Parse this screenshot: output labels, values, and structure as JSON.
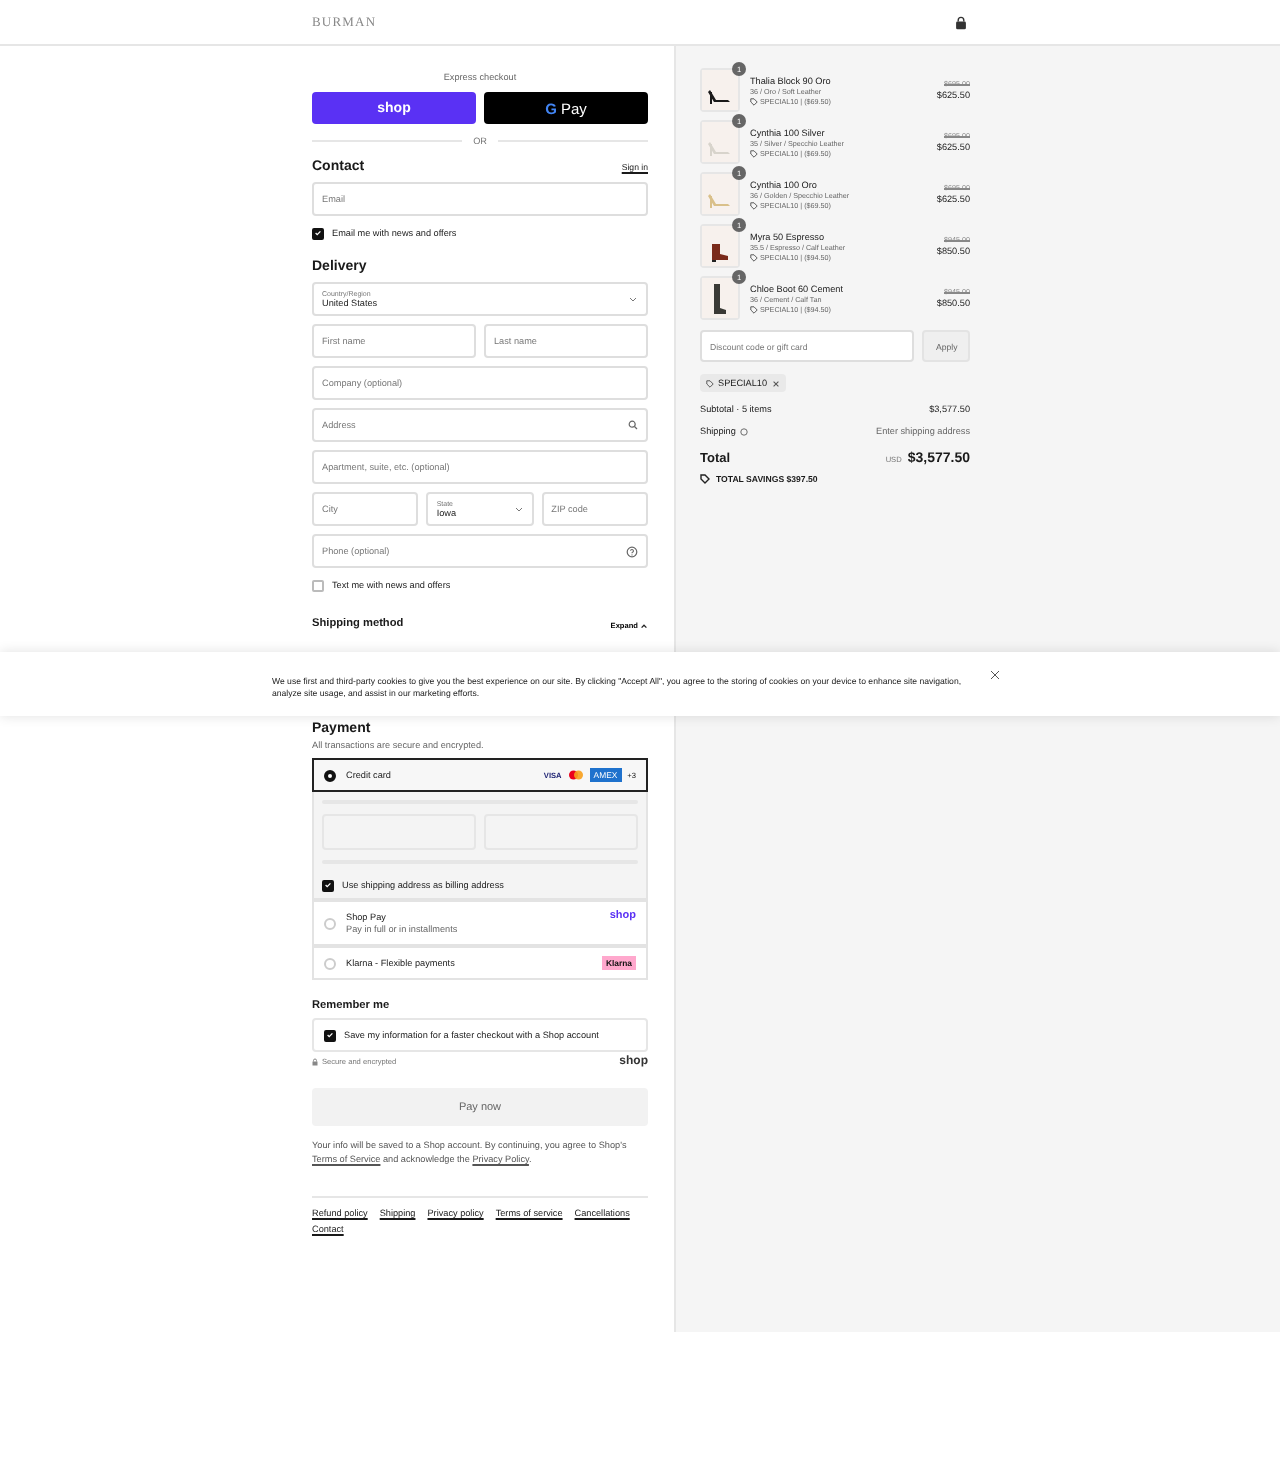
{
  "header": {
    "logo": "BURMAN"
  },
  "express": {
    "title": "Express checkout",
    "buttons": [
      {
        "kind": "shop",
        "label": "shop"
      },
      {
        "kind": "gpay",
        "mark": "G",
        "label": "Pay"
      }
    ],
    "divider": "OR"
  },
  "contact": {
    "heading": "Contact",
    "sign_in": "Sign in",
    "email": {
      "placeholder": "Email"
    },
    "news": {
      "label": "Email me with news and offers",
      "checked": true
    }
  },
  "delivery": {
    "heading": "Delivery",
    "rows": [
      [
        {
          "kind": "select",
          "label": "Country/Region",
          "value": "United States"
        }
      ],
      [
        {
          "kind": "input",
          "placeholder": "First name"
        },
        {
          "kind": "input",
          "placeholder": "Last name"
        }
      ],
      [
        {
          "kind": "input",
          "placeholder": "Company (optional)"
        }
      ],
      [
        {
          "kind": "search_input",
          "placeholder": "Address"
        }
      ],
      [
        {
          "kind": "input",
          "placeholder": "Apartment, suite, etc. (optional)"
        }
      ],
      [
        {
          "kind": "input",
          "placeholder": "City"
        },
        {
          "kind": "select",
          "label": "State",
          "value": "Iowa"
        },
        {
          "kind": "input",
          "placeholder": "ZIP code"
        }
      ],
      [
        {
          "kind": "help_input",
          "placeholder": "Phone (optional)"
        }
      ]
    ],
    "text_me": {
      "label": "Text me with news and offers",
      "checked": false
    }
  },
  "shipping_method": {
    "heading": "Shipping method",
    "expand": "Expand"
  },
  "cookie_banner": {
    "text": "We use first and third-party cookies to give you the best experience on our site. By clicking \"Accept All\", you agree to the storing of cookies on your device to enhance site navigation, analyze site usage, and assist in our marketing efforts."
  },
  "payment": {
    "heading": "Payment",
    "subtitle": "All transactions are secure and encrypted.",
    "methods": [
      {
        "kind": "card",
        "label": "Credit card",
        "selected": true,
        "logos": [
          {
            "kind": "visa",
            "text": "VISA"
          },
          {
            "kind": "mastercard"
          },
          {
            "kind": "amex",
            "text": "AMEX"
          }
        ],
        "more": "+3",
        "billing": {
          "label": "Use shipping address as billing address",
          "checked": true
        }
      },
      {
        "kind": "shoppay",
        "label": "Shop Pay",
        "sublabel": "Pay in full or in installments",
        "badge": "shop",
        "selected": false
      },
      {
        "kind": "klarna",
        "label": "Klarna - Flexible payments",
        "badge": "Klarna",
        "selected": false
      }
    ]
  },
  "remember": {
    "heading": "Remember me",
    "save": {
      "label": "Save my information for a faster checkout with a Shop account",
      "checked": true
    },
    "secure": "Secure and encrypted",
    "shop_logo": "shop"
  },
  "pay_button": "Pay now",
  "legal": [
    {
      "text": "Your info will be saved to a Shop account. By continuing, you agree to Shop's "
    },
    {
      "link": "Terms of Service"
    },
    {
      "text": " and acknowledge the "
    },
    {
      "link": "Privacy Policy"
    },
    {
      "text": "."
    }
  ],
  "footer_links": [
    "Refund policy",
    "Shipping",
    "Privacy policy",
    "Terms of service",
    "Cancellations",
    "Contact"
  ],
  "summary": {
    "items": [
      {
        "name": "Thalia Block 90 Oro",
        "variant": "36 / Oro / Soft Leather",
        "discount": "SPECIAL10 | ($69.50)",
        "original": "$695.00",
        "price": "$625.50",
        "qty": "1"
      },
      {
        "name": "Cynthia 100 Silver",
        "variant": "35 / Silver / Specchio Leather",
        "discount": "SPECIAL10 | ($69.50)",
        "original": "$695.00",
        "price": "$625.50",
        "qty": "1"
      },
      {
        "name": "Cynthia 100 Oro",
        "variant": "36 / Golden / Specchio Leather",
        "discount": "SPECIAL10 | ($69.50)",
        "original": "$695.00",
        "price": "$625.50",
        "qty": "1"
      },
      {
        "name": "Myra 50 Espresso",
        "variant": "35.5 / Espresso / Calf Leather",
        "discount": "SPECIAL10 | ($94.50)",
        "original": "$945.00",
        "price": "$850.50",
        "qty": "1"
      },
      {
        "name": "Chloe Boot 60 Cement",
        "variant": "36 / Cement / Calf Tan",
        "discount": "SPECIAL10 | ($94.50)",
        "original": "$945.00",
        "price": "$850.50",
        "qty": "1"
      }
    ],
    "discount_field": {
      "placeholder": "Discount code or gift card"
    },
    "apply": "Apply",
    "tag": "SPECIAL10",
    "subtotal": {
      "label": "Subtotal · 5 items",
      "value": "$3,577.50"
    },
    "shipping": {
      "label": "Shipping",
      "value": "Enter shipping address"
    },
    "total": {
      "label": "Total",
      "currency": "USD",
      "value": "$3,577.50"
    },
    "savings": "TOTAL SAVINGS $397.50"
  }
}
